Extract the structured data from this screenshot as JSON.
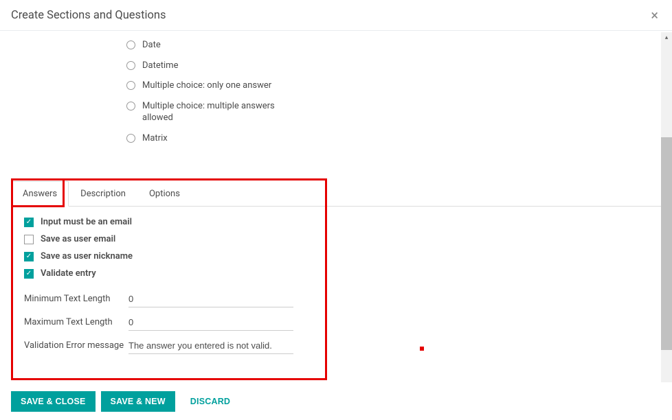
{
  "header": {
    "title": "Create Sections and Questions",
    "close_glyph": "×"
  },
  "radios": [
    {
      "label": "Date"
    },
    {
      "label": "Datetime"
    },
    {
      "label": "Multiple choice: only one answer"
    },
    {
      "label": "Multiple choice: multiple answers allowed"
    },
    {
      "label": "Matrix"
    }
  ],
  "tabs": {
    "answers": "Answers",
    "description": "Description",
    "options": "Options"
  },
  "checks": {
    "input_email": {
      "label": "Input must be an email",
      "checked": true
    },
    "save_email": {
      "label": "Save as user email",
      "checked": false
    },
    "save_nick": {
      "label": "Save as user nickname",
      "checked": true
    },
    "validate": {
      "label": "Validate entry",
      "checked": true
    }
  },
  "fields": {
    "min_len": {
      "label": "Minimum Text Length",
      "value": "0"
    },
    "max_len": {
      "label": "Maximum Text Length",
      "value": "0"
    },
    "err_msg": {
      "label": "Validation Error message",
      "value": "The answer you entered is not valid."
    }
  },
  "footer": {
    "save_close": "Save & Close",
    "save_new": "Save & New",
    "discard": "Discard"
  }
}
